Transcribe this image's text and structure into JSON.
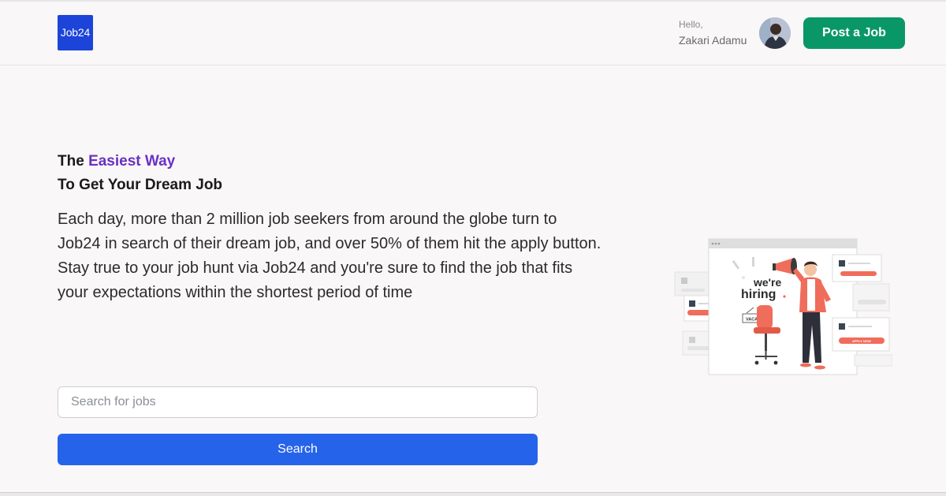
{
  "header": {
    "logo_text": "Job24",
    "greeting": "Hello,",
    "user_name": "Zakari Adamu",
    "post_job_label": "Post a Job"
  },
  "hero": {
    "headline_prefix": "The ",
    "headline_accent": "Easiest Way",
    "headline_line2": "To Get Your Dream Job",
    "description": "Each day, more than 2 million job seekers from around the globe turn to Job24 in search of their dream job, and over 50% of them hit the apply button. Stay true to your job hunt via Job24 and you're sure to find the job that fits your expectations within the shortest period of time"
  },
  "search": {
    "placeholder": "Search for jobs",
    "button_label": "Search"
  },
  "illustration": {
    "hiring_text_1": "we're",
    "hiring_text_2": "hiring",
    "vacant_text": "VACANT",
    "apply_text": "APPLY NOW"
  },
  "colors": {
    "brand_blue": "#1c44d9",
    "post_green": "#0a9768",
    "accent_purple": "#6a30c5",
    "search_blue": "#2563eb",
    "illustration_coral": "#f06c5b"
  }
}
